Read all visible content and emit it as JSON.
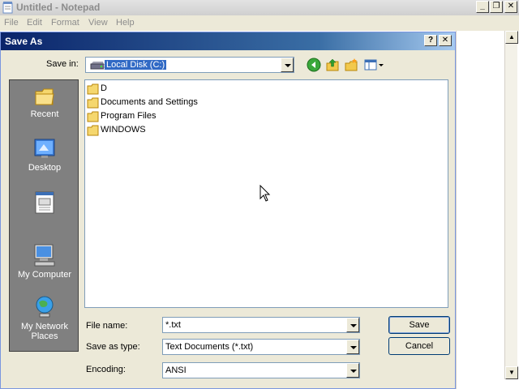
{
  "notepad": {
    "title": "Untitled - Notepad",
    "menu": [
      "File",
      "Edit",
      "Format",
      "View",
      "Help"
    ],
    "controls": {
      "minimize": "_",
      "maximize": "❐",
      "close": "✕"
    }
  },
  "dialog": {
    "title": "Save As",
    "help_button": "?",
    "close_button": "✕",
    "save_in_label": "Save in:",
    "save_in_value": "Local Disk (C:)",
    "toolbar_icons": [
      "back-icon",
      "up-folder-icon",
      "new-folder-icon",
      "views-menu-icon"
    ],
    "places": [
      {
        "label": "Recent",
        "icon": "recent-folder-icon"
      },
      {
        "label": "Desktop",
        "icon": "desktop-icon"
      },
      {
        "label": "",
        "icon": "my-documents-icon"
      },
      {
        "label": "My Computer",
        "icon": "my-computer-icon"
      },
      {
        "label": "My Network Places",
        "icon": "network-places-icon"
      }
    ],
    "files": [
      "D",
      "Documents and Settings",
      "Program Files",
      "WINDOWS"
    ],
    "file_name_label": "File name:",
    "file_name_value": "*.txt",
    "save_as_type_label": "Save as type:",
    "save_as_type_value": "Text Documents (*.txt)",
    "encoding_label": "Encoding:",
    "encoding_value": "ANSI",
    "save_button": "Save",
    "cancel_button": "Cancel"
  },
  "colors": {
    "title_gradient_start": "#0a246a",
    "title_gradient_end": "#a6caf0",
    "dialog_face": "#ece9d8",
    "places_bar": "#808080",
    "selection": "#316ac5"
  }
}
